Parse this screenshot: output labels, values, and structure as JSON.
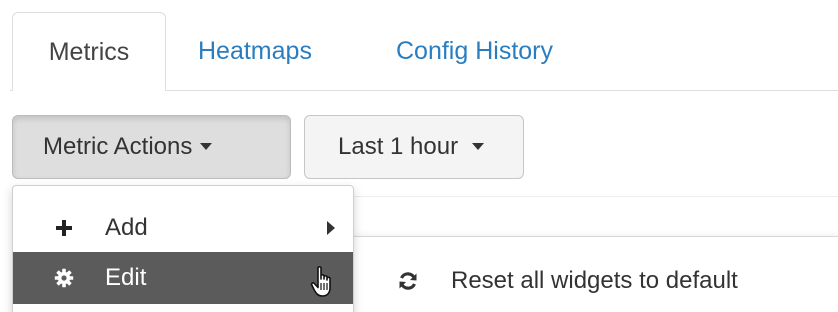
{
  "tabs": [
    {
      "label": "Metrics",
      "active": true
    },
    {
      "label": "Heatmaps",
      "active": false
    },
    {
      "label": "Config History",
      "active": false
    }
  ],
  "toolbar": {
    "metric_actions_label": "Metric Actions",
    "time_range_label": "Last 1 hour"
  },
  "metric_actions_menu": {
    "items": [
      {
        "label": "Add",
        "icon": "plus-icon",
        "has_submenu": true
      },
      {
        "label": "Edit",
        "icon": "gear-icon",
        "highlighted": true
      }
    ]
  },
  "edit_submenu": {
    "items": [
      {
        "label": "Reset all widgets to default",
        "icon": "refresh-icon"
      }
    ]
  },
  "colors": {
    "link": "#2a7ec0",
    "highlight_bg": "#5b5b5b",
    "highlight_text": "#ffffff",
    "active_button_bg": "#dedede"
  },
  "icons": {
    "cursor": "hand-pointer-icon"
  }
}
